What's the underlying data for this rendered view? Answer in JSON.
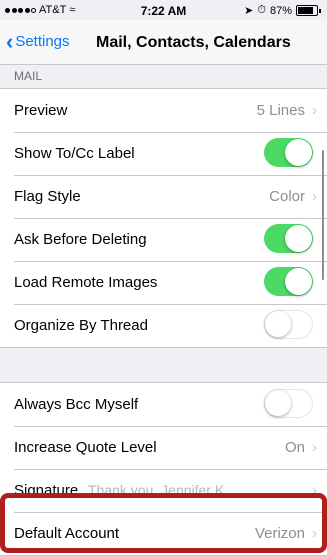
{
  "status_bar": {
    "carrier": "AT&T",
    "time": "7:22 AM",
    "battery": "87%",
    "battery_level": 0.87
  },
  "nav": {
    "back_label": "Settings",
    "title": "Mail, Contacts, Calendars"
  },
  "mail_section": {
    "header": "MAIL",
    "preview_label": "Preview",
    "preview_value": "5 Lines",
    "show_tocc_label": "Show To/Cc Label",
    "show_tocc_on": true,
    "flag_style_label": "Flag Style",
    "flag_style_value": "Color",
    "ask_before_deleting_label": "Ask Before Deleting",
    "ask_before_deleting_on": true,
    "load_remote_images_label": "Load Remote Images",
    "load_remote_images_on": true,
    "organize_by_thread_label": "Organize By Thread",
    "organize_by_thread_on": false
  },
  "compose_section": {
    "always_bcc_label": "Always Bcc Myself",
    "always_bcc_on": false,
    "increase_quote_label": "Increase Quote Level",
    "increase_quote_value": "On",
    "signature_label": "Signature",
    "signature_value": "Thank you, Jennifer K...",
    "default_account_label": "Default Account",
    "default_account_value": "Verizon"
  },
  "colors": {
    "accent": "#007aff",
    "toggle_on": "#4cd964",
    "highlight": "#b01e1e"
  }
}
